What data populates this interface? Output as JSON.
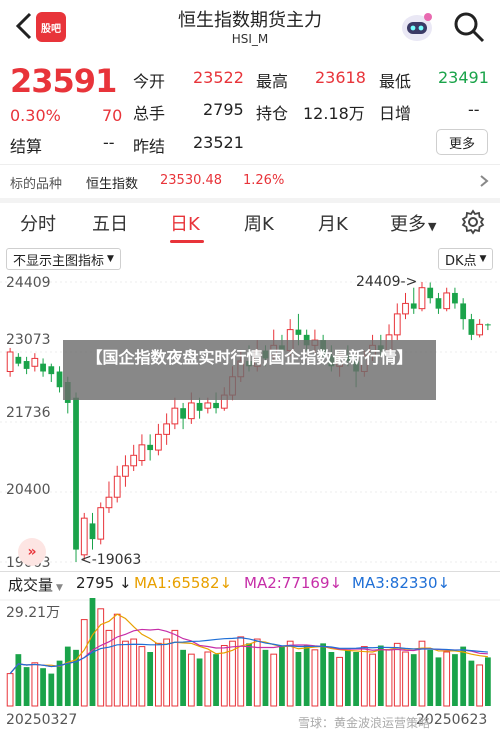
{
  "header": {
    "logo_text": "股吧",
    "title": "恒生指数期货主力",
    "subtitle": "HSI_M"
  },
  "quote": {
    "price": "23591",
    "pct": "0.30%",
    "change": "70",
    "settle_label": "结算",
    "settle_value": "--",
    "open_label": "今开",
    "open_value": "23522",
    "high_label": "最高",
    "high_value": "23618",
    "low_label": "最低",
    "low_value": "23491",
    "volume_label": "总手",
    "volume_value": "2795",
    "hold_label": "持仓",
    "hold_value": "12.18万",
    "dayinc_label": "日增",
    "dayinc_value": "--",
    "prev_label": "昨结",
    "prev_value": "23521",
    "more_label": "更多"
  },
  "target": {
    "label": "标的品种",
    "name": "恒生指数",
    "value": "23530.48",
    "pct": "1.26%"
  },
  "tabs": [
    "分时",
    "五日",
    "日K",
    "周K",
    "月K",
    "更多"
  ],
  "active_tab": "日K",
  "chart_controls": {
    "indicator_select": "不显示主图指标",
    "dk_select": "DK点"
  },
  "chart_data": {
    "type": "candlestick",
    "y_ticks": [
      "24409",
      "23073",
      "21736",
      "20400",
      "19063"
    ],
    "annotations": {
      "high": "24409->",
      "low": "<-19063"
    },
    "candles": [
      [
        22700,
        23073,
        22600,
        23150
      ],
      [
        22980,
        22850,
        22800,
        23050
      ],
      [
        22900,
        22750,
        22650,
        22980
      ],
      [
        22800,
        22950,
        22700,
        23050
      ],
      [
        22850,
        22700,
        22600,
        22950
      ],
      [
        22800,
        22650,
        22500,
        22850
      ],
      [
        22700,
        22400,
        22300,
        22800
      ],
      [
        22500,
        22100,
        21900,
        22600
      ],
      [
        22200,
        19300,
        19063,
        22300
      ],
      [
        19200,
        19900,
        19100,
        20000
      ],
      [
        19800,
        19500,
        19300,
        20000
      ],
      [
        19500,
        20100,
        19400,
        20200
      ],
      [
        20100,
        20300,
        20000,
        20600
      ],
      [
        20300,
        20700,
        20200,
        20900
      ],
      [
        20700,
        20900,
        20500,
        21100
      ],
      [
        20900,
        21100,
        20800,
        21300
      ],
      [
        21000,
        21300,
        20900,
        21500
      ],
      [
        21300,
        21200,
        21000,
        21500
      ],
      [
        21200,
        21500,
        21100,
        21700
      ],
      [
        21500,
        21700,
        21300,
        21900
      ],
      [
        21700,
        22000,
        21600,
        22200
      ],
      [
        22000,
        21800,
        21600,
        22100
      ],
      [
        21800,
        22100,
        21700,
        22300
      ],
      [
        22100,
        21950,
        21800,
        22200
      ],
      [
        22000,
        22100,
        21900,
        22200
      ],
      [
        22100,
        22000,
        21900,
        22300
      ],
      [
        22000,
        22250,
        21950,
        22400
      ],
      [
        22250,
        22600,
        22150,
        22800
      ],
      [
        22600,
        22900,
        22500,
        23100
      ],
      [
        22900,
        22800,
        22700,
        23200
      ],
      [
        22800,
        23100,
        22700,
        23300
      ],
      [
        23100,
        22950,
        22800,
        23200
      ],
      [
        23000,
        23200,
        22900,
        23500
      ],
      [
        23200,
        23100,
        22900,
        23400
      ],
      [
        23100,
        23500,
        23000,
        23700
      ],
      [
        23500,
        23400,
        23200,
        23800
      ],
      [
        23400,
        23200,
        23100,
        23500
      ],
      [
        23200,
        23300,
        23000,
        23500
      ],
      [
        23300,
        23000,
        22900,
        23400
      ],
      [
        23000,
        22800,
        22700,
        23200
      ],
      [
        22800,
        23000,
        22600,
        23100
      ],
      [
        23000,
        22900,
        22800,
        23200
      ],
      [
        22900,
        22700,
        22400,
        23000
      ],
      [
        22700,
        23000,
        22600,
        23100
      ],
      [
        23000,
        23200,
        22900,
        23400
      ],
      [
        23200,
        23100,
        23000,
        23400
      ],
      [
        23100,
        23400,
        23000,
        23600
      ],
      [
        23400,
        23800,
        23300,
        24000
      ],
      [
        23800,
        24000,
        23700,
        24200
      ],
      [
        24000,
        23900,
        23800,
        24300
      ],
      [
        23900,
        24300,
        23850,
        24409
      ],
      [
        24300,
        24100,
        24000,
        24400
      ],
      [
        24100,
        23900,
        23800,
        24200
      ],
      [
        23900,
        24200,
        23850,
        24300
      ],
      [
        24200,
        24000,
        23900,
        24300
      ],
      [
        24000,
        23700,
        23500,
        24100
      ],
      [
        23700,
        23400,
        23300,
        23800
      ],
      [
        23400,
        23600,
        23350,
        23700
      ],
      [
        23600,
        23591,
        23491,
        23618
      ]
    ]
  },
  "volume": {
    "label": "成交量",
    "value": "2795",
    "ma1": "MA1:65582",
    "ma2": "MA2:77169",
    "ma3": "MA3:82330",
    "y_max": "29.21万",
    "date_start": "20250327",
    "date_end": "20250623",
    "bars": [
      30,
      48,
      36,
      40,
      35,
      30,
      42,
      55,
      52,
      80,
      100,
      90,
      70,
      85,
      60,
      62,
      55,
      50,
      58,
      62,
      70,
      52,
      48,
      44,
      50,
      48,
      56,
      60,
      64,
      58,
      62,
      52,
      48,
      55,
      60,
      50,
      56,
      52,
      58,
      50,
      45,
      52,
      50,
      55,
      48,
      56,
      52,
      58,
      50,
      48,
      60,
      52,
      45,
      50,
      48,
      55,
      42,
      38,
      45
    ]
  },
  "banner": {
    "text": "【国企指数夜盘实时行情,国企指数最新行情】"
  },
  "watermark": "雪球：黄金波浪运营策略",
  "colors": {
    "up": "#e8343a",
    "down": "#1aa34a",
    "ma1": "#e8a000",
    "ma2": "#c62ea8",
    "ma3": "#1f6fd6"
  }
}
